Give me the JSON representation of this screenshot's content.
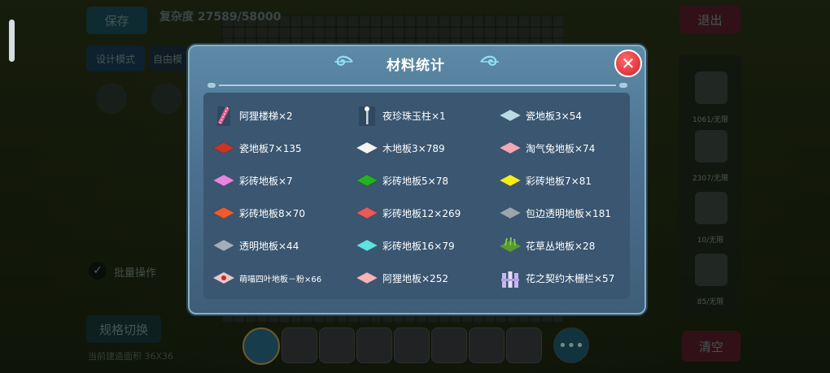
{
  "background": {
    "save_button": "保存",
    "complexity": "复杂度 27589/58000",
    "design_mode": "设计模式",
    "free_label": "自由模",
    "exit_button": "退出",
    "check_label": "批量操作",
    "switch_button": "规格切换",
    "area_label": "当前建造面积 36X36",
    "clear_button": "清空",
    "side_counts": [
      "1061/无限",
      "2307/无限",
      "10/无限",
      "85/无限"
    ]
  },
  "modal": {
    "title": "材料统计",
    "close": "✕",
    "items": [
      {
        "label": "阿狸楼梯×2",
        "icon": "ladder-icon",
        "color": "#e45a8a"
      },
      {
        "label": "夜珍珠玉柱×1",
        "icon": "pillar-icon",
        "color": "#cfd6da"
      },
      {
        "label": "瓷地板3×54",
        "icon": "tile-icon",
        "color": "#b9dbe3"
      },
      {
        "label": "瓷地板7×135",
        "icon": "tile-icon",
        "color": "#c6372a"
      },
      {
        "label": "木地板3×789",
        "icon": "tile-icon",
        "color": "#f4f4f4"
      },
      {
        "label": "淘气兔地板×74",
        "icon": "tile-icon",
        "color": "#f2a9b5"
      },
      {
        "label": "彩砖地板×7",
        "icon": "tile-icon",
        "color": "#e884e0"
      },
      {
        "label": "彩砖地板5×78",
        "icon": "tile-icon",
        "color": "#23b51f"
      },
      {
        "label": "彩砖地板7×81",
        "icon": "tile-icon",
        "color": "#f4ee1a"
      },
      {
        "label": "彩砖地板8×70",
        "icon": "tile-icon",
        "color": "#f05b2a"
      },
      {
        "label": "彩砖地板12×269",
        "icon": "tile-icon",
        "color": "#e85a5a"
      },
      {
        "label": "包边透明地板×181",
        "icon": "tile-icon",
        "color": "#9aa6ac"
      },
      {
        "label": "透明地板×44",
        "icon": "tile-icon",
        "color": "#9fb0bb"
      },
      {
        "label": "彩砖地板16×79",
        "icon": "tile-icon",
        "color": "#5fe0e2"
      },
      {
        "label": "花草丛地板×28",
        "icon": "grass-icon",
        "color": "#5a9a2a"
      },
      {
        "label": "萌喵四叶地板－粉×66",
        "icon": "clover-tile-icon",
        "color": "#f0c4c8"
      },
      {
        "label": "阿狸地板×252",
        "icon": "tile-icon",
        "color": "#f6b4b9"
      },
      {
        "label": "花之契约木栅栏×57",
        "icon": "fence-icon",
        "color": "#c9b6ef"
      }
    ]
  }
}
